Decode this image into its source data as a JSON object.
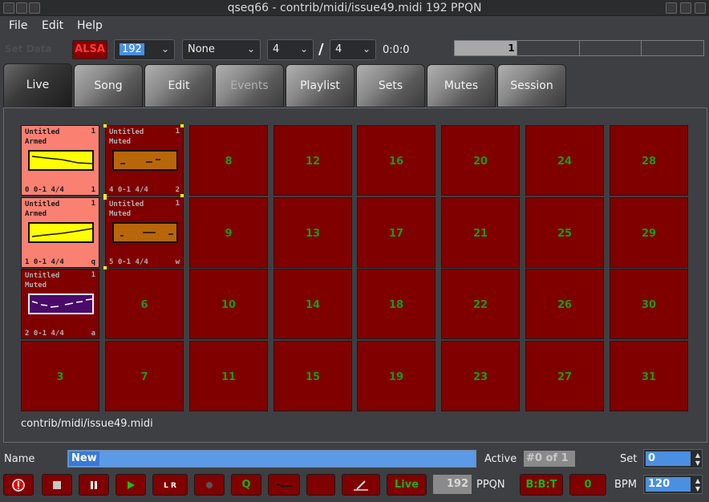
{
  "window": {
    "title": "qseq66 - contrib/midi/issue49.midi 192 PPQN"
  },
  "menu": {
    "file": "File",
    "edit": "Edit",
    "help": "Help"
  },
  "toolbar": {
    "ghost_label": "Set Data",
    "alsa_label": "ALSA",
    "ppqn_value": "192",
    "snap_value": "None",
    "beats_per_bar": "4",
    "beat_width": "4",
    "position": "0:0:0",
    "beat_indicator": [
      "1",
      "",
      "",
      ""
    ]
  },
  "tabs": [
    {
      "label": "Live",
      "active": true
    },
    {
      "label": "Song"
    },
    {
      "label": "Edit"
    },
    {
      "label": "Events",
      "disabled": true
    },
    {
      "label": "Playlist"
    },
    {
      "label": "Sets"
    },
    {
      "label": "Mutes"
    },
    {
      "label": "Session"
    }
  ],
  "slots": [
    {
      "number": "0",
      "title": "Untitled",
      "state": "Armed",
      "top_right": "1",
      "bottom": "0  0-1 4/4",
      "key": "1",
      "preview": "yellow"
    },
    {
      "number": "1",
      "title": "Untitled",
      "state": "Armed",
      "top_right": "1",
      "bottom": "1  0-1 4/4",
      "key": "q",
      "preview": "yellow"
    },
    {
      "number": "2",
      "title": "Untitled",
      "state": "Muted",
      "top_right": "1",
      "bottom": "2  0-1 4/4",
      "key": "a",
      "preview": "purple"
    },
    {
      "number": "3"
    },
    {
      "number": "4",
      "title": "Untitled",
      "state": "Muted",
      "top_right": "1",
      "bottom": "4  0-1 4/4",
      "key": "2",
      "preview": "brown"
    },
    {
      "number": "5",
      "title": "Untitled",
      "state": "Muted",
      "top_right": "1",
      "bottom": "5  0-1 4/4",
      "key": "w",
      "preview": "brown"
    },
    {
      "number": "6"
    },
    {
      "number": "7"
    },
    {
      "number": "8"
    },
    {
      "number": "9"
    },
    {
      "number": "10"
    },
    {
      "number": "11"
    },
    {
      "number": "12"
    },
    {
      "number": "13"
    },
    {
      "number": "14"
    },
    {
      "number": "15"
    },
    {
      "number": "16"
    },
    {
      "number": "17"
    },
    {
      "number": "18"
    },
    {
      "number": "19"
    },
    {
      "number": "20"
    },
    {
      "number": "21"
    },
    {
      "number": "22"
    },
    {
      "number": "23"
    },
    {
      "number": "24"
    },
    {
      "number": "25"
    },
    {
      "number": "26"
    },
    {
      "number": "27"
    },
    {
      "number": "28"
    },
    {
      "number": "29"
    },
    {
      "number": "30"
    },
    {
      "number": "31"
    }
  ],
  "filename": "contrib/midi/issue49.midi",
  "bottom": {
    "name_label": "Name",
    "name_value": "New",
    "active_label": "Active",
    "active_value": "#0 of 1",
    "set_label": "Set",
    "set_value": "0",
    "live_label": "Live",
    "ppqn_value": "192",
    "ppqn_label": "PPQN",
    "bbt_label": "B:B:T",
    "tap_value": "0",
    "bpm_label": "BPM",
    "bpm_value": "120",
    "q_label": "Q",
    "loop_label": "L R"
  },
  "colors": {
    "slot_empty": "#800000",
    "slot_armed": "#fa8072",
    "slot_number": "#1a9a1a",
    "accent_blue": "#4a8fe0"
  },
  "icons": {
    "panic": "exclamation-icon",
    "stop": "stop-icon",
    "pause": "pause-icon",
    "play": "play-icon",
    "loop": "loop-icon",
    "record": "record-icon",
    "quantize": "quantize-icon",
    "keep_queue": "keep-queue-icon",
    "song_record": "song-record-icon",
    "tap": "tap-icon"
  }
}
